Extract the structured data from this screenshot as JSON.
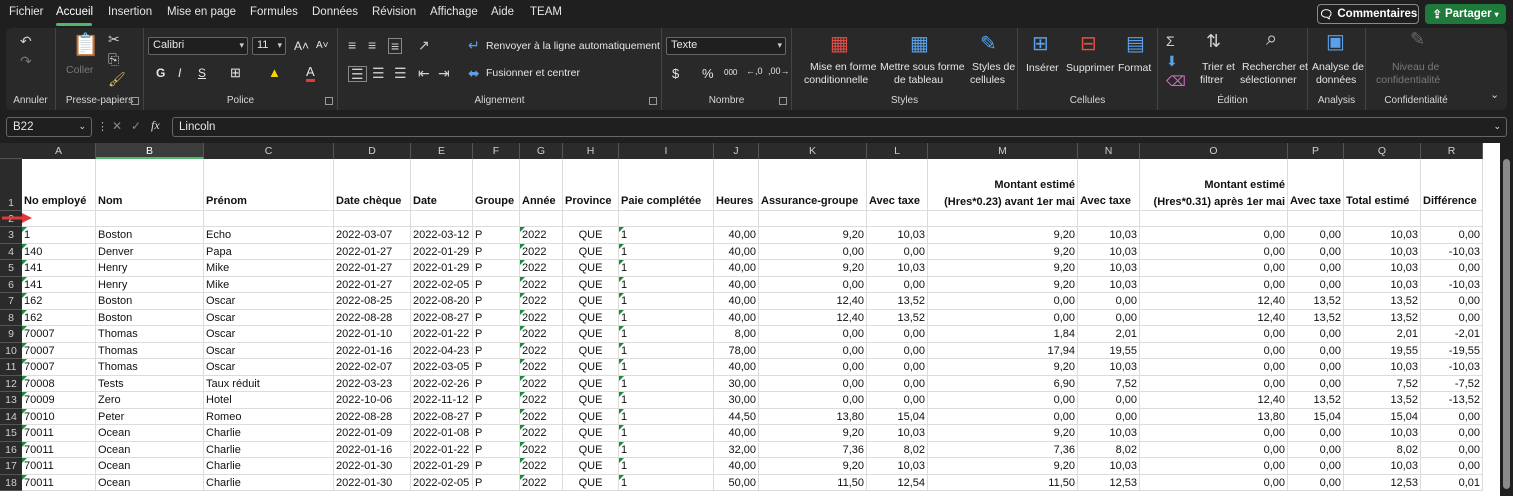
{
  "menu": {
    "items": [
      "Fichier",
      "Accueil",
      "Insertion",
      "Mise en page",
      "Formules",
      "Données",
      "Révision",
      "Affichage",
      "Aide",
      "TEAM"
    ],
    "active": "Accueil",
    "comments": "Commentaires",
    "share": "Partager"
  },
  "ribbon": {
    "annuler": {
      "label": "Annuler"
    },
    "presse": {
      "label": "Presse-papiers",
      "coller": "Coller"
    },
    "police": {
      "label": "Police",
      "font": "Calibri",
      "size": "11"
    },
    "alignement": {
      "label": "Alignement",
      "wrap": "Renvoyer à la ligne automatiquement",
      "merge": "Fusionner et centrer"
    },
    "nombre": {
      "label": "Nombre",
      "format": "Texte"
    },
    "styles": {
      "label": "Styles",
      "cond1": "Mise en forme",
      "cond2": "conditionnelle",
      "table1": "Mettre sous forme",
      "table2": "de tableau",
      "cell1": "Styles de",
      "cell2": "cellules"
    },
    "cellules": {
      "label": "Cellules",
      "insert": "Insérer",
      "delete": "Supprimer",
      "format": "Format"
    },
    "edition": {
      "label": "Édition",
      "sort1": "Trier et",
      "sort2": "filtrer",
      "find1": "Rechercher et",
      "find2": "sélectionner"
    },
    "analysis": {
      "label": "Analysis",
      "a1": "Analyse de",
      "a2": "données"
    },
    "conf": {
      "label": "Confidentialité",
      "c1": "Niveau de",
      "c2": "confidentialité"
    }
  },
  "formula_bar": {
    "name_box": "B22",
    "content": "Lincoln",
    "fx": "fx"
  },
  "columns": [
    "A",
    "B",
    "C",
    "D",
    "E",
    "F",
    "G",
    "H",
    "I",
    "J",
    "K",
    "L",
    "M",
    "N",
    "O",
    "P",
    "Q",
    "R"
  ],
  "selected_column": "B",
  "header_row": [
    "No employé",
    "Nom",
    "Prénom",
    "Date chèque",
    "Date",
    "Groupe",
    "Année",
    "Province",
    "Paie complétée",
    "Heures",
    "Assurance-groupe",
    "Avec taxe",
    "Montant estimé (Hres*0.23) avant 1er mai",
    "Avec taxe",
    "Montant estimé (Hres*0.31) après 1er mai",
    "Avec taxe",
    "Total estimé",
    "Différence"
  ],
  "header_row_m_top": "Montant estimé",
  "header_row_m_bottom": "(Hres*0.23) avant 1er mai",
  "header_row_o_top": "Montant estimé",
  "header_row_o_bottom": "(Hres*0.31) après 1er mai",
  "rows": [
    {
      "n": "3",
      "cells": [
        "1",
        "Boston",
        "Echo",
        "2022-03-07",
        "2022-03-12",
        "P",
        "2022",
        "QUE",
        "1",
        "40,00",
        "9,20",
        "10,03",
        "9,20",
        "10,03",
        "0,00",
        "0,00",
        "10,03",
        "0,00"
      ]
    },
    {
      "n": "4",
      "cells": [
        "140",
        "Denver",
        "Papa",
        "2022-01-27",
        "2022-01-29",
        "P",
        "2022",
        "QUE",
        "1",
        "40,00",
        "0,00",
        "0,00",
        "9,20",
        "10,03",
        "0,00",
        "0,00",
        "10,03",
        "-10,03"
      ]
    },
    {
      "n": "5",
      "cells": [
        "141",
        "Henry",
        "Mike",
        "2022-01-27",
        "2022-01-29",
        "P",
        "2022",
        "QUE",
        "1",
        "40,00",
        "9,20",
        "10,03",
        "9,20",
        "10,03",
        "0,00",
        "0,00",
        "10,03",
        "0,00"
      ]
    },
    {
      "n": "6",
      "cells": [
        "141",
        "Henry",
        "Mike",
        "2022-01-27",
        "2022-02-05",
        "P",
        "2022",
        "QUE",
        "1",
        "40,00",
        "0,00",
        "0,00",
        "9,20",
        "10,03",
        "0,00",
        "0,00",
        "10,03",
        "-10,03"
      ]
    },
    {
      "n": "7",
      "cells": [
        "162",
        "Boston",
        "Oscar",
        "2022-08-25",
        "2022-08-20",
        "P",
        "2022",
        "QUE",
        "1",
        "40,00",
        "12,40",
        "13,52",
        "0,00",
        "0,00",
        "12,40",
        "13,52",
        "13,52",
        "0,00"
      ]
    },
    {
      "n": "8",
      "cells": [
        "162",
        "Boston",
        "Oscar",
        "2022-08-28",
        "2022-08-27",
        "P",
        "2022",
        "QUE",
        "1",
        "40,00",
        "12,40",
        "13,52",
        "0,00",
        "0,00",
        "12,40",
        "13,52",
        "13,52",
        "0,00"
      ]
    },
    {
      "n": "9",
      "cells": [
        "70007",
        "Thomas",
        "Oscar",
        "2022-01-10",
        "2022-01-22",
        "P",
        "2022",
        "QUE",
        "1",
        "8,00",
        "0,00",
        "0,00",
        "1,84",
        "2,01",
        "0,00",
        "0,00",
        "2,01",
        "-2,01"
      ]
    },
    {
      "n": "10",
      "cells": [
        "70007",
        "Thomas",
        "Oscar",
        "2022-01-16",
        "2022-04-23",
        "P",
        "2022",
        "QUE",
        "1",
        "78,00",
        "0,00",
        "0,00",
        "17,94",
        "19,55",
        "0,00",
        "0,00",
        "19,55",
        "-19,55"
      ]
    },
    {
      "n": "11",
      "cells": [
        "70007",
        "Thomas",
        "Oscar",
        "2022-02-07",
        "2022-03-05",
        "P",
        "2022",
        "QUE",
        "1",
        "40,00",
        "0,00",
        "0,00",
        "9,20",
        "10,03",
        "0,00",
        "0,00",
        "10,03",
        "-10,03"
      ]
    },
    {
      "n": "12",
      "cells": [
        "70008",
        "Tests",
        "Taux réduit",
        "2022-03-23",
        "2022-02-26",
        "P",
        "2022",
        "QUE",
        "1",
        "30,00",
        "0,00",
        "0,00",
        "6,90",
        "7,52",
        "0,00",
        "0,00",
        "7,52",
        "-7,52"
      ]
    },
    {
      "n": "13",
      "cells": [
        "70009",
        "Zero",
        "Hotel",
        "2022-10-06",
        "2022-11-12",
        "P",
        "2022",
        "QUE",
        "1",
        "30,00",
        "0,00",
        "0,00",
        "0,00",
        "0,00",
        "12,40",
        "13,52",
        "13,52",
        "-13,52"
      ]
    },
    {
      "n": "14",
      "cells": [
        "70010",
        "Peter",
        "Romeo",
        "2022-08-28",
        "2022-08-27",
        "P",
        "2022",
        "QUE",
        "1",
        "44,50",
        "13,80",
        "15,04",
        "0,00",
        "0,00",
        "13,80",
        "15,04",
        "15,04",
        "0,00"
      ]
    },
    {
      "n": "15",
      "cells": [
        "70011",
        "Ocean",
        "Charlie",
        "2022-01-09",
        "2022-01-08",
        "P",
        "2022",
        "QUE",
        "1",
        "40,00",
        "9,20",
        "10,03",
        "9,20",
        "10,03",
        "0,00",
        "0,00",
        "10,03",
        "0,00"
      ]
    },
    {
      "n": "16",
      "cells": [
        "70011",
        "Ocean",
        "Charlie",
        "2022-01-16",
        "2022-01-22",
        "P",
        "2022",
        "QUE",
        "1",
        "32,00",
        "7,36",
        "8,02",
        "7,36",
        "8,02",
        "0,00",
        "0,00",
        "8,02",
        "0,00"
      ]
    },
    {
      "n": "17",
      "cells": [
        "70011",
        "Ocean",
        "Charlie",
        "2022-01-30",
        "2022-01-29",
        "P",
        "2022",
        "QUE",
        "1",
        "40,00",
        "9,20",
        "10,03",
        "9,20",
        "10,03",
        "0,00",
        "0,00",
        "10,03",
        "0,00"
      ]
    },
    {
      "n": "18",
      "cells": [
        "70011",
        "Ocean",
        "Charlie",
        "2022-01-30",
        "2022-02-05",
        "P",
        "2022",
        "QUE",
        "1",
        "50,00",
        "11,50",
        "12,54",
        "11,50",
        "12,53",
        "0,00",
        "0,00",
        "12,53",
        "0,01"
      ]
    }
  ],
  "colors": {
    "accent_green": "#4cba6a",
    "share_green": "#1e7a3a",
    "arrow_red": "#e03a3a"
  }
}
